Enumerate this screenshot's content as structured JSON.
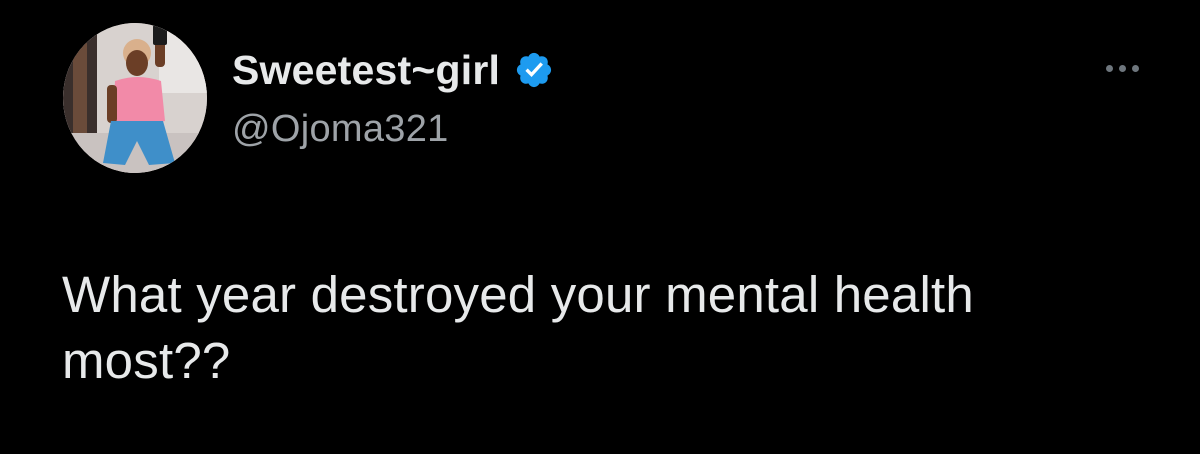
{
  "author": {
    "display_name": "Sweetest~girl",
    "handle": "@Ojoma321",
    "verified": true,
    "avatar_icon": "profile-photo",
    "verified_icon": "verified-badge-icon",
    "verified_color": "#1d9bf0"
  },
  "tweet": {
    "text_lines": [
      "What year destroyed your mental health",
      "most??"
    ]
  },
  "actions": {
    "more_icon": "more-options-icon"
  },
  "colors": {
    "background": "#000000",
    "primary_text": "#e7e9ea",
    "secondary_text": "#9ea3a8"
  }
}
